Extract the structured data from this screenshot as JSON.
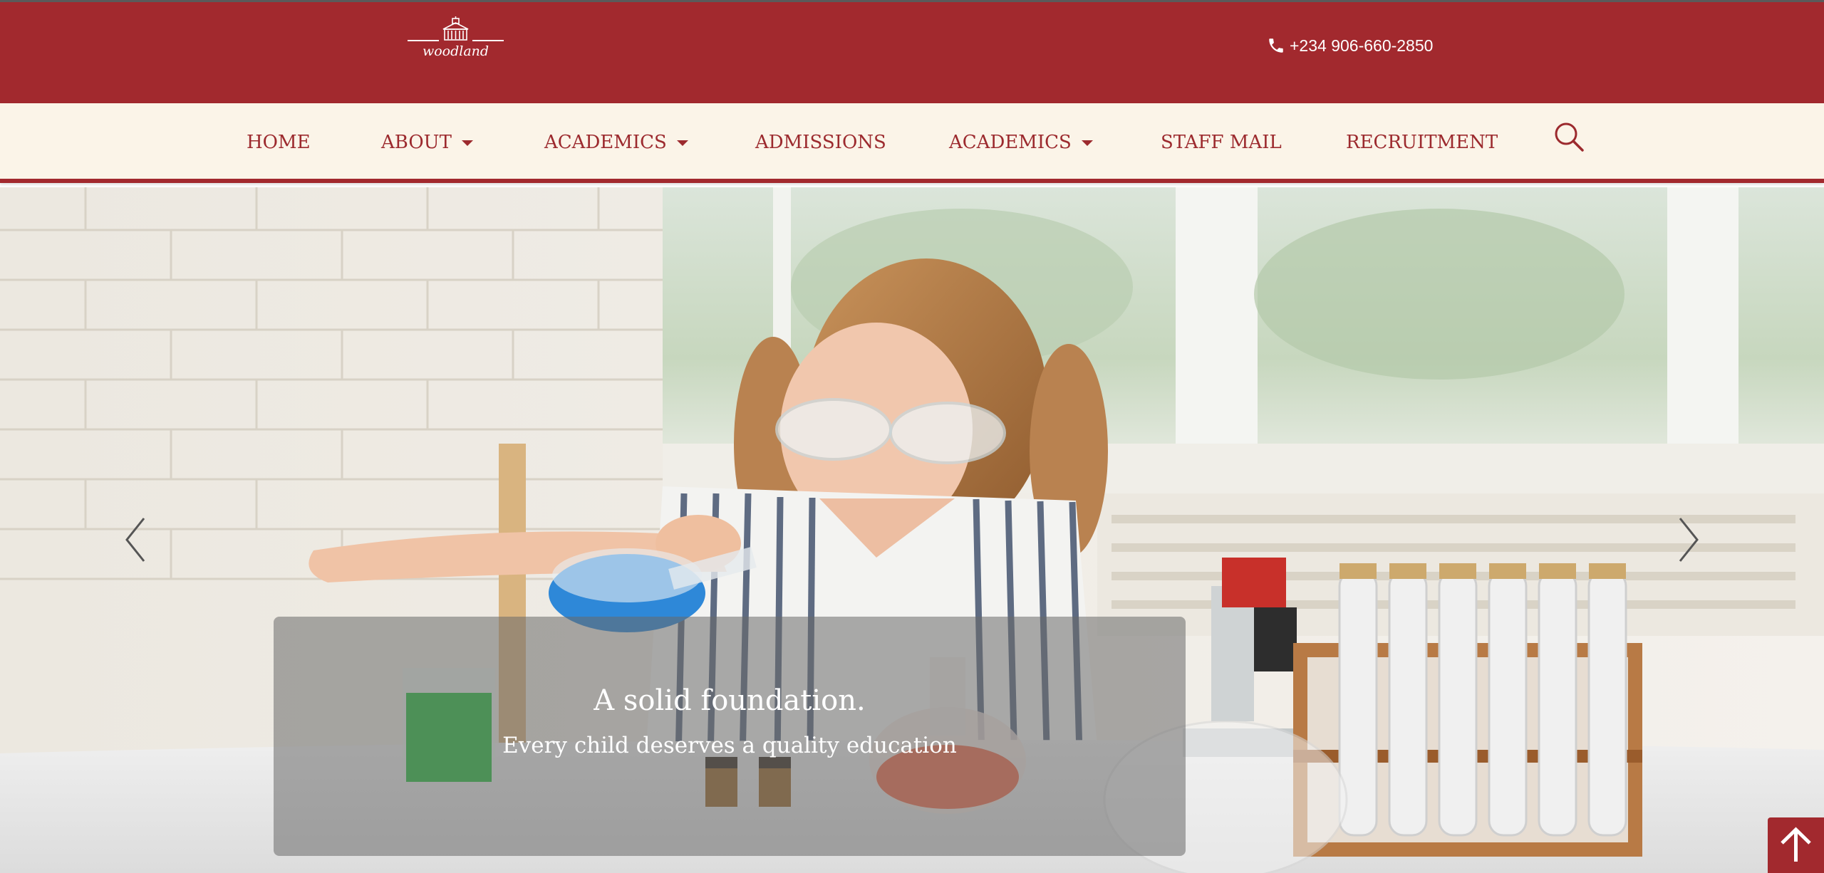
{
  "header": {
    "logo_text": "woodland",
    "phone": "+234 906-660-2850",
    "phone_icon": "phone-icon",
    "colors": {
      "brand": "#a2292e",
      "nav_background": "#fbf4e8",
      "nav_text": "#9c2a2e"
    }
  },
  "nav": {
    "items": [
      {
        "label": "HOME",
        "dropdown": false
      },
      {
        "label": "ABOUT",
        "dropdown": true
      },
      {
        "label": "ACADEMICS",
        "dropdown": true
      },
      {
        "label": "ADMISSIONS",
        "dropdown": false
      },
      {
        "label": "ACADEMICS",
        "dropdown": true
      },
      {
        "label": "STAFF MAIL",
        "dropdown": false
      },
      {
        "label": "RECRUITMENT",
        "dropdown": false
      }
    ],
    "search_icon": "search-icon"
  },
  "hero": {
    "caption_title": "A solid foundation.",
    "caption_subtitle": "Every child deserves a quality education",
    "prev_icon": "chevron-left-icon",
    "next_icon": "chevron-right-icon"
  },
  "scroll_top_icon": "arrow-up-icon"
}
